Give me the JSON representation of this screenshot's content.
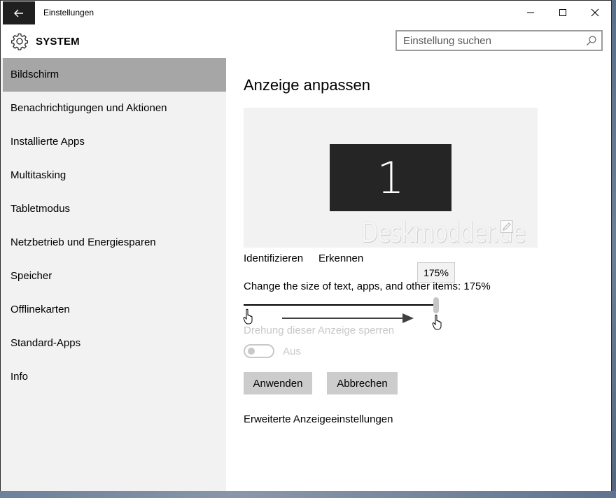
{
  "window": {
    "title": "Einstellungen",
    "back_icon": "arrow-left-icon",
    "controls": [
      "minimize-icon",
      "maximize-icon",
      "close-icon"
    ]
  },
  "header": {
    "section_icon": "gear-icon",
    "section_title": "SYSTEM",
    "search_placeholder": "Einstellung suchen"
  },
  "sidebar": {
    "items": [
      {
        "label": "Bildschirm",
        "active": true
      },
      {
        "label": "Benachrichtigungen und Aktionen"
      },
      {
        "label": "Installierte Apps"
      },
      {
        "label": "Multitasking"
      },
      {
        "label": "Tabletmodus"
      },
      {
        "label": "Netzbetrieb und Energiesparen"
      },
      {
        "label": "Speicher"
      },
      {
        "label": "Offlinekarten"
      },
      {
        "label": "Standard-Apps"
      },
      {
        "label": "Info"
      }
    ]
  },
  "main": {
    "title": "Anzeige anpassen",
    "monitor_number": "1",
    "watermark": "Deskmodder.de",
    "identify_label": "Identifizieren",
    "detect_label": "Erkennen",
    "slider_tooltip": "175%",
    "scale_label": "Change the size of text, apps, and other items: 175%",
    "scale_value_fraction": 1.0,
    "rotation_lock_label": "Drehung dieser Anzeige sperren",
    "toggle_state_label": "Aus",
    "apply_label": "Anwenden",
    "cancel_label": "Abbrechen",
    "advanced_label": "Erweiterte Anzeigeeinstellungen"
  },
  "colors": {
    "active_item": "#a6a6a6",
    "sidebar_bg": "#f2f2f2",
    "button_bg": "#cccccc",
    "back_button_bg": "#1f1f1f",
    "disabled_text": "#c8c8c8"
  }
}
